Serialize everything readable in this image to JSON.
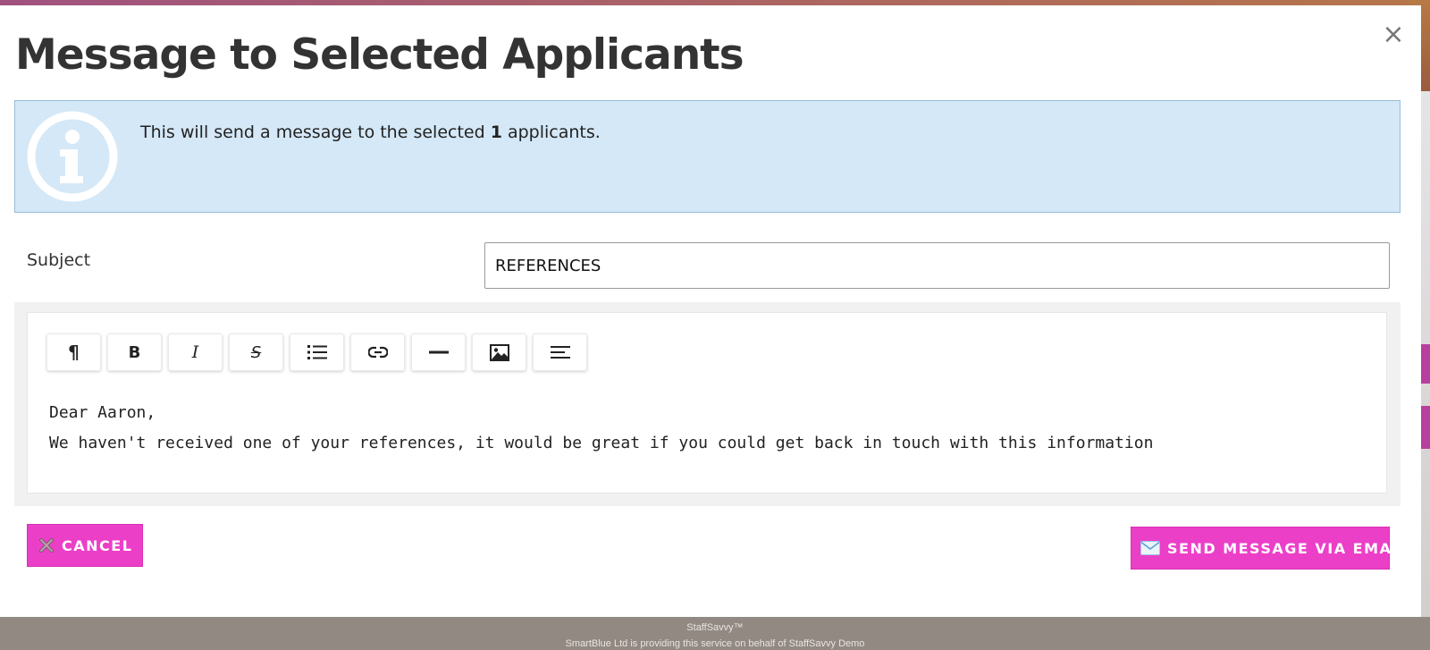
{
  "modal": {
    "title": "Message to Selected Applicants",
    "close_icon": "close-icon"
  },
  "info": {
    "icon": "info-circle-icon",
    "text_before": "This will send a message to the selected ",
    "count": "1",
    "text_after": " applicants."
  },
  "subject": {
    "label": "Subject",
    "value": "REFERENCES"
  },
  "toolbar": {
    "items": [
      {
        "name": "paragraph-icon",
        "glyph": "¶"
      },
      {
        "name": "bold-icon",
        "glyph": "B"
      },
      {
        "name": "italic-icon",
        "glyph": "I"
      },
      {
        "name": "strikethrough-icon",
        "glyph": "S"
      },
      {
        "name": "bullet-list-icon"
      },
      {
        "name": "link-icon"
      },
      {
        "name": "horizontal-rule-icon"
      },
      {
        "name": "image-icon"
      },
      {
        "name": "align-left-icon"
      }
    ]
  },
  "editor": {
    "line1": "Dear Aaron,",
    "line2": "We haven't received one of your references, it would be great if you could get back in touch with this information"
  },
  "actions": {
    "cancel_label": "CANCEL",
    "cancel_icon": "cross-icon",
    "send_label": "SEND MESSAGE VIA EMAIL",
    "send_icon": "envelope-icon"
  },
  "footer": {
    "brand": "StaffSavvy™",
    "line2": "SmartBlue Ltd is providing this service on behalf of StaffSavvy Demo"
  },
  "colors": {
    "accent": "#ec3fc8",
    "info_bg": "#d4e8f7",
    "info_border": "#99bdd8"
  }
}
